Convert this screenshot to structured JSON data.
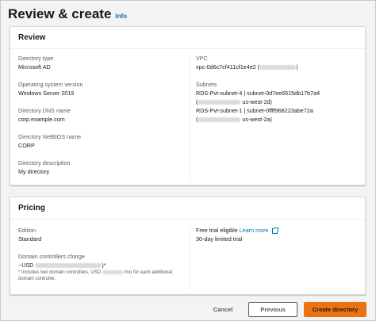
{
  "page": {
    "title": "Review & create",
    "info": "Info"
  },
  "review": {
    "heading": "Review",
    "left": [
      {
        "label": "Directory type",
        "value": "Microsoft AD"
      },
      {
        "label": "Operating system version",
        "value": "Windows Server 2019"
      },
      {
        "label": "Directory DNS name",
        "value": "corp.example.com"
      },
      {
        "label": "Directory NetBIOS name",
        "value": "CORP"
      },
      {
        "label": "Directory description",
        "value": "My directory"
      }
    ],
    "vpc": {
      "label": "VPC",
      "id": "vpc-0d6c7cf411cf1e4e2 (",
      "close": ")"
    },
    "subnets": {
      "label": "Subnets",
      "items": [
        {
          "line1": "RDS-Pvt-subnet-4 | subnet-0d7ee6515db17b7a4",
          "open": "(",
          "region": "us-west-2d)"
        },
        {
          "line1": "RDS-Pvt-subnet-1 | subnet-0ffff968223abe72a",
          "open": "(",
          "region": "us-west-2a)"
        }
      ]
    }
  },
  "pricing": {
    "heading": "Pricing",
    "edition": {
      "label": "Edition",
      "value": "Standard"
    },
    "free_trial": {
      "label": "Free trial eligible",
      "link": "Learn more",
      "value": "30-day limited trial"
    },
    "domain_controllers": {
      "label": "Domain controllers charge",
      "prefix": "~USD",
      "suffix": ")*",
      "note_part1": "* Includes two domain controllers, USD",
      "note_part2": "/mo for each additional",
      "note_part3": "domain controller."
    }
  },
  "footer": {
    "cancel": "Cancel",
    "previous": "Previous",
    "create": "Create directory"
  },
  "colors": {
    "primary": "#ec7211",
    "link": "#0073bb"
  },
  "icons": {
    "learn_more": "external-link-icon"
  }
}
